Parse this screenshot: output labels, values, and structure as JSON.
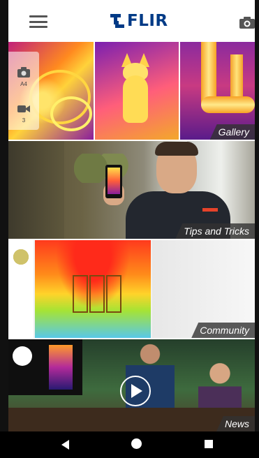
{
  "header": {
    "logo_text": "FLIR",
    "brand_color": "#003a86"
  },
  "side_panel": {
    "photo_count": "A4",
    "video_count": "3"
  },
  "tiles": [
    {
      "label": "Gallery"
    },
    {
      "label": "Tips and Tricks"
    },
    {
      "label": "Community"
    },
    {
      "label": "News"
    }
  ]
}
